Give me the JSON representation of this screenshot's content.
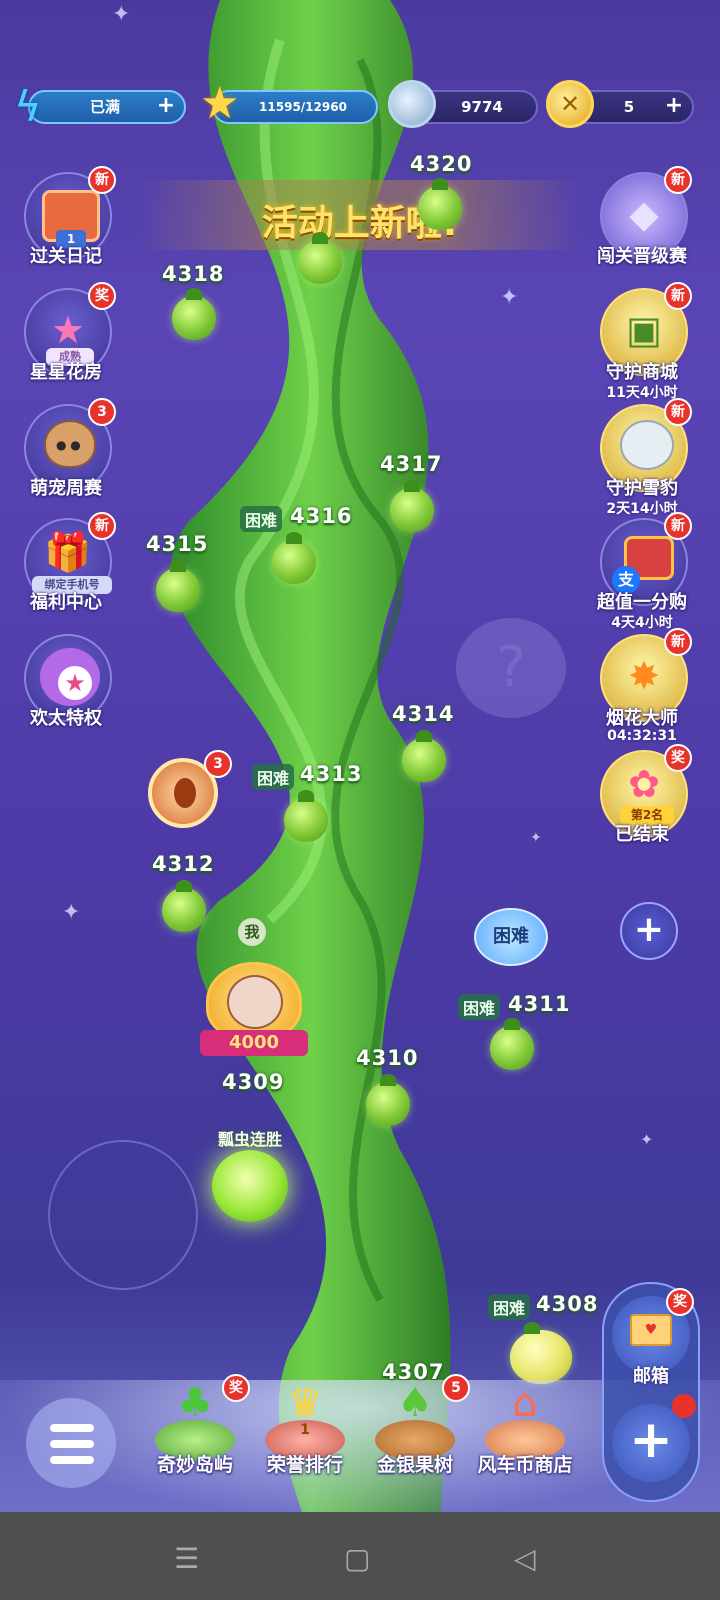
{
  "topbar": {
    "energy": {
      "value": "已满",
      "plus": "+",
      "icon": "lightning-icon"
    },
    "stars": {
      "value": "11595/12960",
      "icon": "star-icon"
    },
    "coins": {
      "value": "9774",
      "icon": "silver-coin-icon"
    },
    "gold": {
      "value": "5",
      "plus": "+",
      "icon": "gold-coin-icon"
    }
  },
  "banner": {
    "text": "活动上新啦!"
  },
  "left_menu": [
    {
      "label": "过关日记",
      "badge": "新",
      "icon": "diary-icon",
      "inner": "1"
    },
    {
      "label": "星星花房",
      "badge": "奖",
      "icon": "flower-house-icon",
      "inner": "成熟"
    },
    {
      "label": "萌宠周赛",
      "badge": "3",
      "icon": "cat-icon"
    },
    {
      "label": "福利中心",
      "badge": "新",
      "icon": "gift-icon",
      "inner": "绑定手机号"
    },
    {
      "label": "欢太特权",
      "icon": "owl-privilege-icon"
    }
  ],
  "right_menu": [
    {
      "label": "闯关晋级赛",
      "badge": "新",
      "icon": "trophy-badge-icon"
    },
    {
      "label": "守护商城",
      "sub": "11天4小时",
      "badge": "新",
      "icon": "panda-shop-icon"
    },
    {
      "label": "守护雪豹",
      "sub": "2天14小时",
      "badge": "新",
      "icon": "snow-leopard-icon"
    },
    {
      "label": "超值一分购",
      "sub": "4天4小时",
      "badge": "新",
      "icon": "treasure-chest-icon",
      "inner": "支"
    },
    {
      "label": "烟花大师",
      "sub": "04:32:31",
      "badge": "新",
      "icon": "firework-icon"
    },
    {
      "label": "已结束",
      "badge": "奖",
      "icon": "balloon-icon",
      "inner": "第2名"
    }
  ],
  "right_add": "+",
  "levels": {
    "l4320": "4320",
    "l4318": "4318",
    "l4317": "4317",
    "l4316": "4316",
    "l4315": "4315",
    "l4314": "4314",
    "l4313": "4313",
    "l4312": "4312",
    "l4311": "4311",
    "l4310": "4310",
    "l4309": "4309",
    "l4308": "4308",
    "l4307": "4307"
  },
  "hard_label": "困难",
  "hard_flower": "困难",
  "player": {
    "me": "我",
    "score": "4000",
    "streak": "瓢虫连胜"
  },
  "compass_badge": "3",
  "mailbox": {
    "label": "邮箱",
    "badge": "奖"
  },
  "bottom_nav": [
    {
      "label": "奇妙岛屿",
      "badge": "奖",
      "icon": "island-icon"
    },
    {
      "label": "荣誉排行",
      "icon": "crown-icon",
      "inner": "1"
    },
    {
      "label": "金银果树",
      "badge": "5",
      "icon": "fruit-tree-icon"
    },
    {
      "label": "风车币商店",
      "icon": "shop-icon"
    }
  ]
}
